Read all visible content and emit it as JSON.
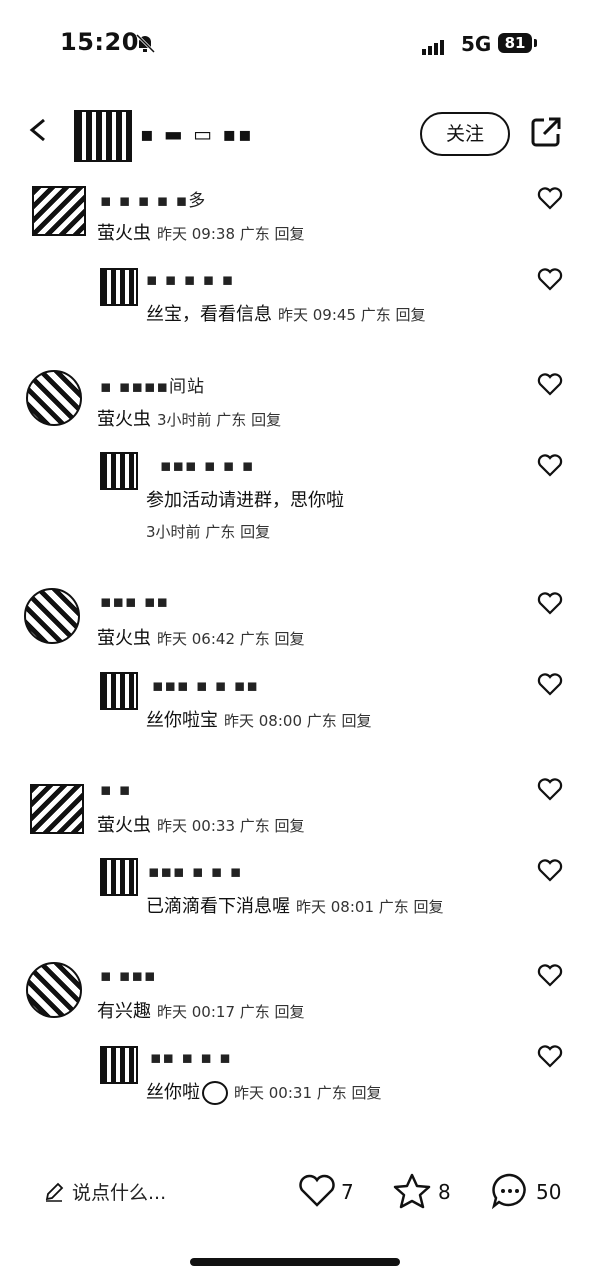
{
  "status_bar": {
    "time": "15:20",
    "network": "5G",
    "battery": "81"
  },
  "header": {
    "username": "▪ ▬ ▭ ▪▪",
    "follow_label": "关注"
  },
  "comments": [
    {
      "user": "▪ ▪ ▪ ▪ ▪多",
      "text": "萤火虫",
      "meta": "昨天 09:38 广东 回复",
      "reply": {
        "user": "▪ ▪ ▪ ▪ ▪",
        "text": "丝宝，看看信息",
        "meta": "昨天 09:45 广东 回复"
      }
    },
    {
      "user": "▪ ▪▪▪▪间站",
      "text": "萤火虫",
      "meta": "3小时前 广东 回复",
      "reply": {
        "user": "▪▪▪ ▪ ▪ ▪",
        "text": "参加活动请进群，思你啦",
        "meta": "3小时前 广东 回复"
      }
    },
    {
      "user": "▪▪▪ ▪▪",
      "text": "萤火虫",
      "meta": "昨天 06:42 广东 回复",
      "reply": {
        "user": "▪▪▪ ▪ ▪ ▪▪",
        "text": "丝你啦宝",
        "meta": "昨天 08:00 广东 回复"
      }
    },
    {
      "user": "▪ ▪",
      "text": "萤火虫",
      "meta": "昨天 00:33 广东 回复",
      "reply": {
        "user": "▪▪▪ ▪ ▪ ▪",
        "text": "已滴滴看下消息喔",
        "meta": "昨天 08:01 广东 回复"
      }
    },
    {
      "user": "▪ ▪▪▪",
      "text": "有兴趣",
      "meta": "昨天 00:17 广东 回复",
      "reply": {
        "user": "▪▪ ▪ ▪ ▪",
        "text": "丝你啦",
        "meta": "昨天 00:31 广东 回复"
      }
    }
  ],
  "bottom_bar": {
    "placeholder": "说点什么...",
    "likes": "7",
    "favorites": "8",
    "comments": "50"
  }
}
